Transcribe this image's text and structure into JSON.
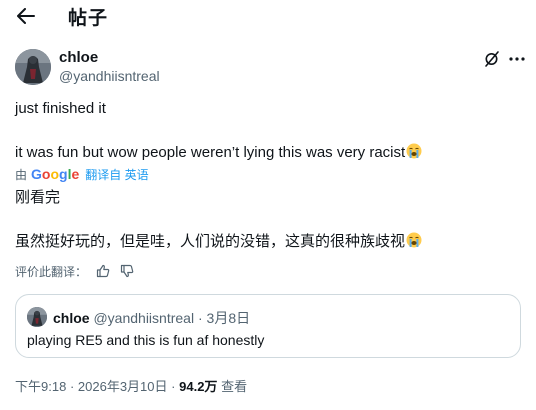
{
  "header": {
    "title": "帖子"
  },
  "post": {
    "author_name": "chloe",
    "author_handle": "@yandhiisntreal",
    "text_line1": "just finished it",
    "text_line2": "it was fun but wow people weren’t lying this was very racist",
    "emoji": "loudly-crying-face",
    "translation": {
      "by": "由",
      "brand": "Google",
      "translated_from": "翻译自 英语",
      "line1": "刚看完",
      "line2": "虽然挺好玩的，但是哇，人们说的没错，这真的很种族歧视"
    },
    "rate_translation_label": "评价此翻译：",
    "quoted": {
      "author_name": "chloe",
      "author_handle": "@yandhiisntreal",
      "separator": "·",
      "date": "3月8日",
      "text": "playing RE5 and this is fun af honestly"
    },
    "meta": {
      "time": "下午9:18",
      "separator": "·",
      "date": "2026年3月10日",
      "separator2": "·",
      "views_count": "94.2万",
      "views_label": "查看"
    }
  },
  "colors": {
    "text_primary": "#0f1419",
    "text_secondary": "#536471",
    "link": "#1d9bf0",
    "border": "#cfd9de",
    "google_blue": "#4285F4",
    "google_red": "#EA4335",
    "google_yellow": "#FBBC05",
    "google_green": "#34A853"
  }
}
